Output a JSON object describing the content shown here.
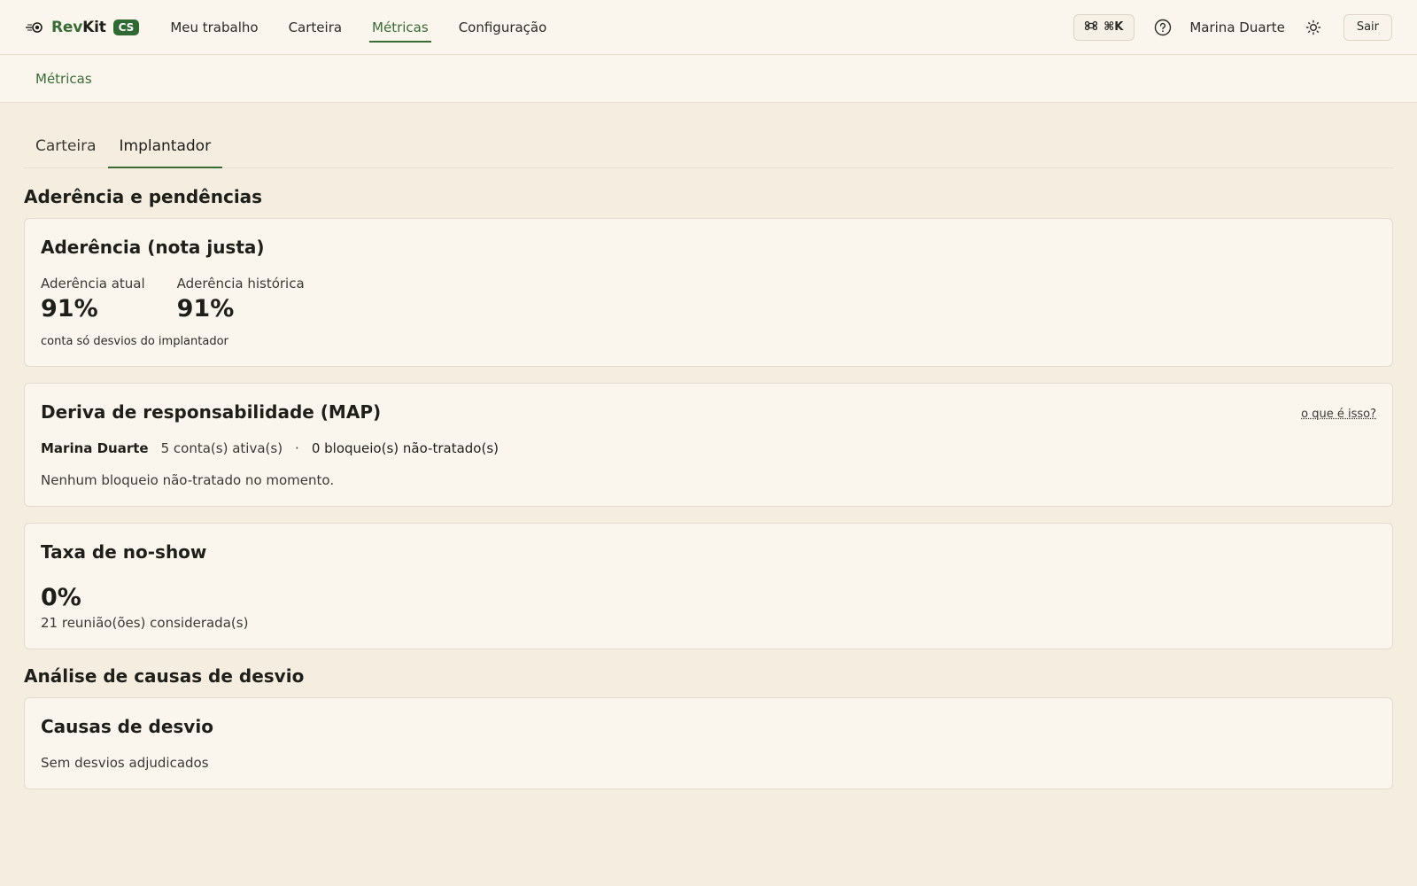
{
  "brand": {
    "name_prefix": "Rev",
    "name_suffix": "Kit",
    "badge": "CS"
  },
  "nav": {
    "items": [
      {
        "label": "Meu trabalho"
      },
      {
        "label": "Carteira"
      },
      {
        "label": "Métricas"
      },
      {
        "label": "Configuração"
      }
    ],
    "active": "Métricas"
  },
  "topright": {
    "command_label": "⌘K",
    "username": "Marina Duarte",
    "logout_label": "Sair"
  },
  "breadcrumb": "Métricas",
  "tabs": [
    {
      "label": "Carteira"
    },
    {
      "label": "Implantador"
    }
  ],
  "active_tab": "Implantador",
  "sections": {
    "adherence_section_title": "Aderência e pendências",
    "causes_section_title": "Análise de causas de desvio"
  },
  "adherence_card": {
    "title": "Aderência (nota justa)",
    "current_label": "Aderência atual",
    "current_value": "91%",
    "historical_label": "Aderência histórica",
    "historical_value": "91%",
    "note": "conta só desvios do implantador"
  },
  "map_card": {
    "title": "Deriva de responsabilidade (MAP)",
    "link": "o que é isso?",
    "name": "Marina Duarte",
    "accounts": "5 conta(s) ativa(s)",
    "separator": "·",
    "blocks": "0 bloqueio(s) não-tratado(s)",
    "message": "Nenhum bloqueio não-tratado no momento."
  },
  "noshow_card": {
    "title": "Taxa de no-show",
    "value": "0%",
    "sub": "21 reunião(ões) considerada(s)"
  },
  "causes_card": {
    "title": "Causas de desvio",
    "message": "Sem desvios adjudicados"
  },
  "colors": {
    "accent": "#3a6b35",
    "background": "#f4ede0",
    "surface": "#faf6ee"
  }
}
